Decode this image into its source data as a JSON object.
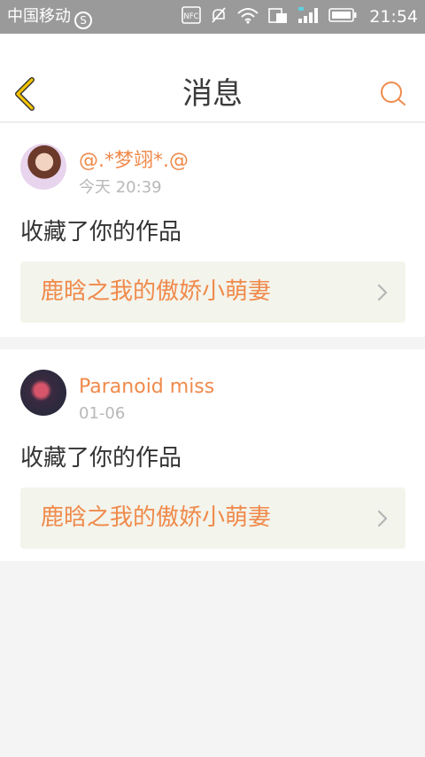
{
  "status_bar": {
    "carrier": "中国移动",
    "carrier_icon_glyph": "S",
    "time": "21:54",
    "icons": [
      "nfc-icon",
      "mute-icon",
      "wifi-icon",
      "data-icon",
      "signal-icon",
      "battery-icon"
    ],
    "nfc_label": "NFC"
  },
  "header": {
    "title": "消息",
    "back_icon": "chevron-left-icon",
    "search_icon": "search-icon"
  },
  "colors": {
    "accent": "#f08a4b",
    "back_arrow": "#f5c400",
    "status_bar": "#9a9a9a",
    "card_link_bg": "#f3f4ec"
  },
  "messages": [
    {
      "username": "@.*梦翊*.@",
      "time": "今天 20:39",
      "action": "收藏了你的作品",
      "work_title": "鹿晗之我的傲娇小萌妻"
    },
    {
      "username": "Paranoid miss",
      "time": "01-06",
      "action": "收藏了你的作品",
      "work_title": "鹿晗之我的傲娇小萌妻"
    }
  ]
}
